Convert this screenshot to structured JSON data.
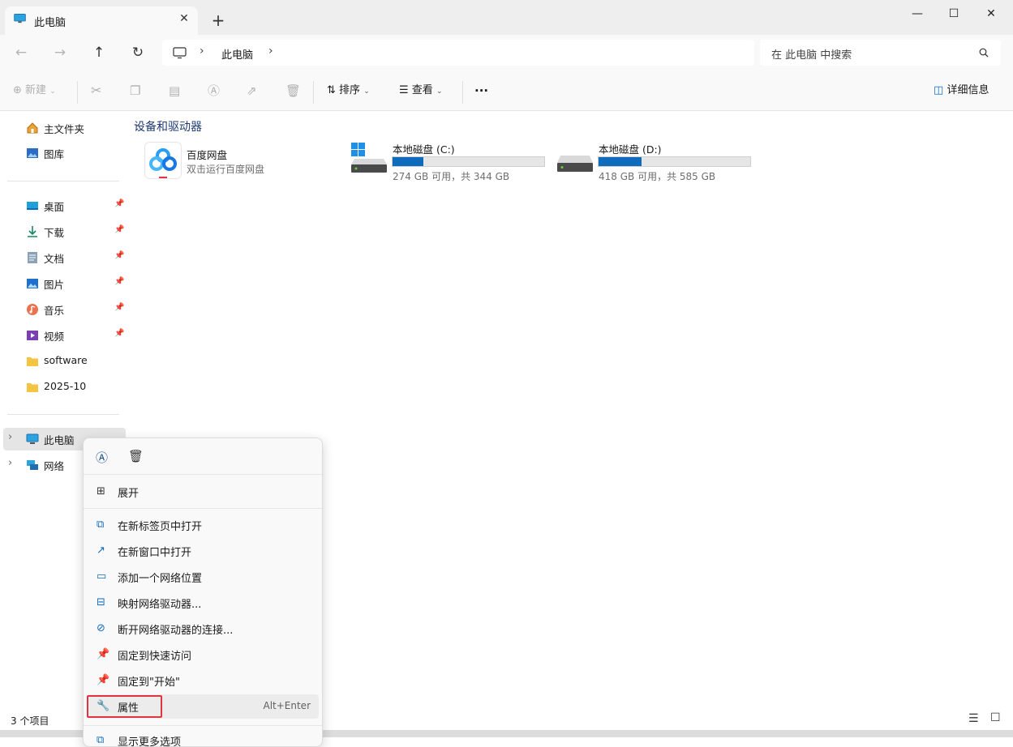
{
  "tab": {
    "title": "此电脑",
    "close": "✕",
    "new_tab": "+"
  },
  "window": {
    "minimize": "—",
    "maximize": "☐",
    "close": "✕"
  },
  "nav": {
    "back": "←",
    "forward": "→",
    "up": "↑",
    "refresh": "↻",
    "breadcrumb": [
      "此电脑"
    ],
    "search_placeholder": "在 此电脑 中搜索"
  },
  "toolbar": {
    "new": "新建",
    "sort": "排序",
    "view": "查看",
    "more": "···",
    "details": "详细信息"
  },
  "sidebar": {
    "top": [
      {
        "label": "主文件夹",
        "icon": "home-icon"
      },
      {
        "label": "图库",
        "icon": "gallery-icon"
      }
    ],
    "pinned": [
      {
        "label": "桌面",
        "icon": "desktop-icon"
      },
      {
        "label": "下载",
        "icon": "download-icon"
      },
      {
        "label": "文档",
        "icon": "documents-icon"
      },
      {
        "label": "图片",
        "icon": "pictures-icon"
      },
      {
        "label": "音乐",
        "icon": "music-icon"
      },
      {
        "label": "视频",
        "icon": "videos-icon"
      }
    ],
    "folders": [
      {
        "label": "software",
        "icon": "folder-icon"
      },
      {
        "label": "2025-10",
        "icon": "folder-icon"
      }
    ],
    "tree": [
      {
        "label": "此电脑",
        "icon": "this-pc-icon"
      },
      {
        "label": "网络",
        "icon": "network-icon"
      }
    ]
  },
  "content": {
    "section_title": "设备和驱动器",
    "app": {
      "name": "百度网盘",
      "sub": "双击运行百度网盘"
    },
    "drives": [
      {
        "name": "本地磁盘 (C:)",
        "sub": "274 GB 可用，共 344 GB",
        "used_fraction": 0.203
      },
      {
        "name": "本地磁盘 (D:)",
        "sub": "418 GB 可用，共 585 GB",
        "used_fraction": 0.285
      }
    ]
  },
  "status": {
    "count": "3 个项目"
  },
  "context_menu": {
    "items": [
      {
        "label": "展开",
        "icon": "expand-icon"
      },
      {
        "label": "在新标签页中打开",
        "icon": "open-new-tab-icon"
      },
      {
        "label": "在新窗口中打开",
        "icon": "open-new-window-icon"
      },
      {
        "label": "添加一个网络位置",
        "icon": "network-location-icon"
      },
      {
        "label": "映射网络驱动器...",
        "icon": "map-drive-icon"
      },
      {
        "label": "断开网络驱动器的连接...",
        "icon": "disconnect-drive-icon"
      },
      {
        "label": "固定到快速访问",
        "icon": "pin-icon"
      },
      {
        "label": "固定到\"开始\"",
        "icon": "pin-start-icon"
      },
      {
        "label": "属性",
        "icon": "wrench-icon",
        "shortcut": "Alt+Enter"
      },
      {
        "label": "显示更多选项",
        "icon": "more-options-icon"
      }
    ],
    "highlight_color": "#e0353f"
  }
}
